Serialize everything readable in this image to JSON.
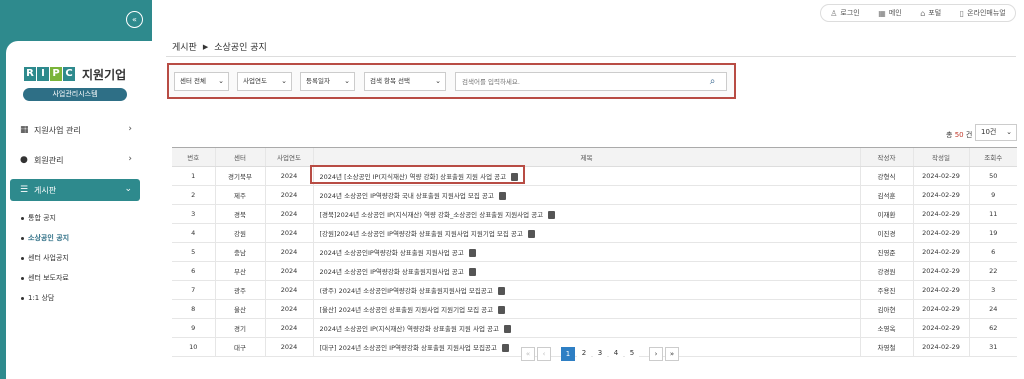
{
  "sidebar": {
    "logo": {
      "letters": [
        "R",
        "I",
        "P",
        "C"
      ],
      "title": "지원기업",
      "badge": "사업관리시스템"
    },
    "menu": [
      {
        "label": "지원사업 관리",
        "icon": "grid-icon"
      },
      {
        "label": "회원관리",
        "icon": "user-icon"
      },
      {
        "label": "게시판",
        "icon": "list-icon"
      }
    ],
    "submenu": [
      {
        "label": "통합 공지"
      },
      {
        "label": "소상공인 공지"
      },
      {
        "label": "센터 사업공지"
      },
      {
        "label": "센터 보도자료"
      },
      {
        "label": "1:1 상담"
      }
    ]
  },
  "topbar": {
    "links": [
      {
        "label": "로그인",
        "icon": "person-icon"
      },
      {
        "label": "메인",
        "icon": "grid-icon"
      },
      {
        "label": "포털",
        "icon": "home-icon"
      },
      {
        "label": "온라인매뉴얼",
        "icon": "book-icon"
      }
    ]
  },
  "breadcrumb": {
    "parent": "게시판",
    "current": "소상공인 공지"
  },
  "filter": {
    "center": "센터 전체",
    "year": "사업연도",
    "date": "등록일자",
    "search_field": "검색 항목 선택",
    "search_placeholder": "검색어를 입력하세요."
  },
  "summary": {
    "total_prefix": "총",
    "total_count": "50",
    "total_suffix": "건",
    "page_size": "10건"
  },
  "table": {
    "headers": [
      "번호",
      "센터",
      "사업연도",
      "제목",
      "작성자",
      "작성일",
      "조회수"
    ],
    "rows": [
      {
        "no": "1",
        "center": "경기북부",
        "year": "2024",
        "title": "2024년 [소상공인 IP(지식재산) 역량 강화] 상표출원 지원 사업 공고",
        "author": "강형식",
        "date": "2024-02-29",
        "views": "50"
      },
      {
        "no": "2",
        "center": "제주",
        "year": "2024",
        "title": "2024년 소상공인 IP역량강화 국내 상표출원 지원사업 모집 공고",
        "author": "김석훈",
        "date": "2024-02-29",
        "views": "9"
      },
      {
        "no": "3",
        "center": "경북",
        "year": "2024",
        "title": "[경북]2024년 소상공인 IP(지식재산) 역량 강화_소상공인 상표출원 지원사업 공고",
        "author": "이재환",
        "date": "2024-02-29",
        "views": "11"
      },
      {
        "no": "4",
        "center": "강원",
        "year": "2024",
        "title": "[강원]2024년 소상공인 IP역량강화 상표출원 지원사업 지원기업 모집 공고",
        "author": "이진경",
        "date": "2024-02-29",
        "views": "19"
      },
      {
        "no": "5",
        "center": "충남",
        "year": "2024",
        "title": "2024년 소상공인IP역량강화 상표출원 지원사업 공고",
        "author": "진영준",
        "date": "2024-02-29",
        "views": "6"
      },
      {
        "no": "6",
        "center": "부산",
        "year": "2024",
        "title": "2024년 소상공인 IP역량강화 상표출원지원사업 공고",
        "author": "강경원",
        "date": "2024-02-29",
        "views": "22"
      },
      {
        "no": "7",
        "center": "광주",
        "year": "2024",
        "title": "(광주) 2024년 소상공인IP역량강화 상표출원지원사업 모집공고",
        "author": "주용진",
        "date": "2024-02-29",
        "views": "3"
      },
      {
        "no": "8",
        "center": "울산",
        "year": "2024",
        "title": "[울산] 2024년 소상공인 상표출원 지원사업 지원기업 모집 공고",
        "author": "김아현",
        "date": "2024-02-29",
        "views": "24"
      },
      {
        "no": "9",
        "center": "경기",
        "year": "2024",
        "title": "2024년 소상공인 IP(지식재산) 역량강화 상표출원 지원 사업 공고",
        "author": "소영옥",
        "date": "2024-02-29",
        "views": "62"
      },
      {
        "no": "10",
        "center": "대구",
        "year": "2024",
        "title": "[대구] 2024년 소상공인 IP역량강화 상표출원 지원사업 모집공고",
        "author": "차영철",
        "date": "2024-02-29",
        "views": "31"
      }
    ]
  },
  "pagination": {
    "first": "«",
    "prev": "‹",
    "pages": [
      "1",
      "2",
      "3",
      "4",
      "5"
    ],
    "current": "1",
    "next": "›",
    "last": "»"
  },
  "colors": {
    "sidebar": "#2e8a8d",
    "highlight": "#b84c44",
    "active_page": "#2e7fc4"
  }
}
